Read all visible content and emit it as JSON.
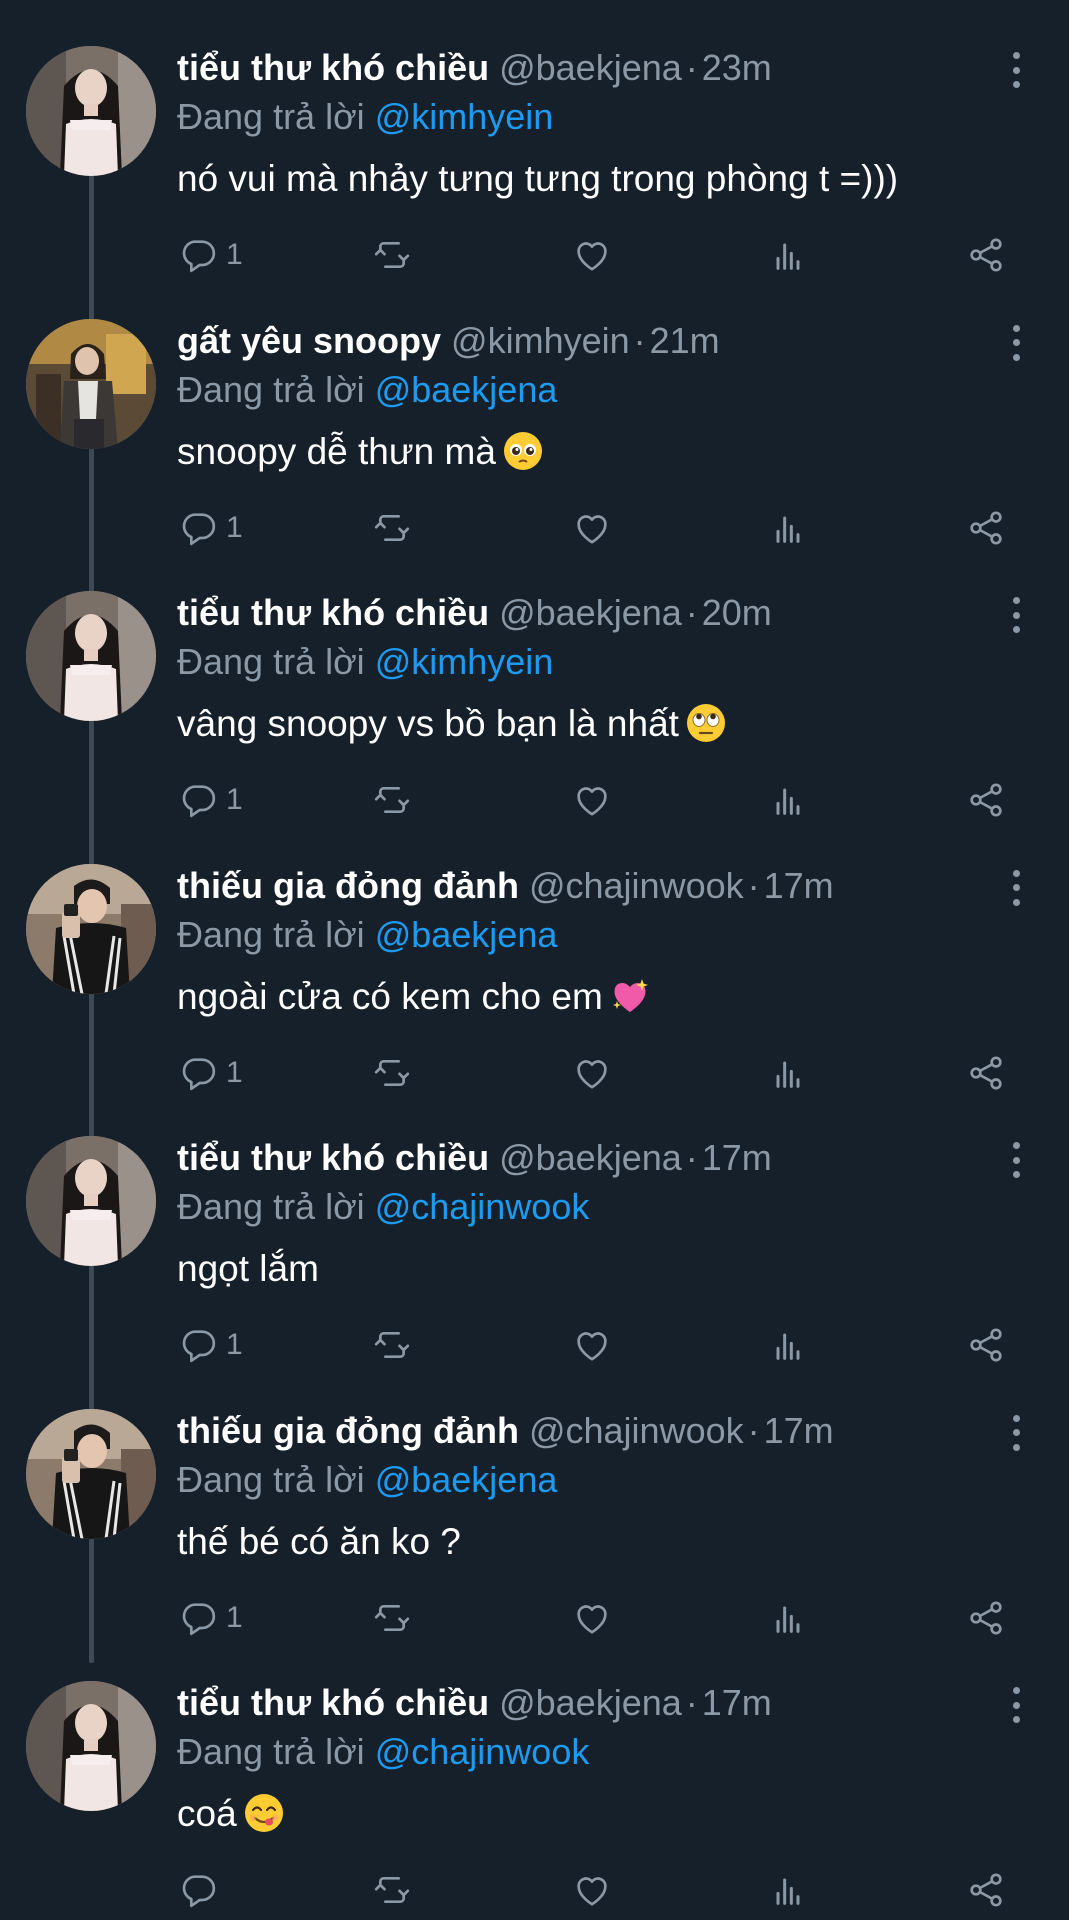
{
  "tweets": [
    {
      "name": "tiểu thư khó chiều",
      "handle": "@baekjena",
      "time": "23m",
      "replying_prefix": "Đang trả lời ",
      "replying_to": "@kimhyein",
      "text": "nó vui mà nhảy tưng tưng trong phòng t =)))",
      "emoji": "",
      "reply_count": "1"
    },
    {
      "name": "gất yêu snoopy",
      "handle": "@kimhyein",
      "time": "21m",
      "replying_prefix": "Đang trả lời ",
      "replying_to": "@baekjena",
      "text": "snoopy dễ thưn mà",
      "emoji": "pleading-face",
      "reply_count": "1"
    },
    {
      "name": "tiểu thư khó chiều",
      "handle": "@baekjena",
      "time": "20m",
      "replying_prefix": "Đang trả lời ",
      "replying_to": "@kimhyein",
      "text": "vâng snoopy vs bồ bạn là nhất",
      "emoji": "rolling-eyes-face",
      "reply_count": "1"
    },
    {
      "name": "thiếu gia đỏng đảnh",
      "handle": "@chajinwook",
      "time": "17m",
      "replying_prefix": "Đang trả lời ",
      "replying_to": "@baekjena",
      "text": "ngoài cửa có kem cho em",
      "emoji": "sparkling-heart",
      "reply_count": "1"
    },
    {
      "name": "tiểu thư khó chiều",
      "handle": "@baekjena",
      "time": "17m",
      "replying_prefix": "Đang trả lời ",
      "replying_to": "@chajinwook",
      "text": "ngọt lắm",
      "emoji": "",
      "reply_count": "1"
    },
    {
      "name": "thiếu gia đỏng đảnh",
      "handle": "@chajinwook",
      "time": "17m",
      "replying_prefix": "Đang trả lời ",
      "replying_to": "@baekjena",
      "text": "thế bé có ăn ko ?",
      "emoji": "",
      "reply_count": "1"
    },
    {
      "name": "tiểu thư khó chiều",
      "handle": "@baekjena",
      "time": "17m",
      "replying_prefix": "Đang trả lời ",
      "replying_to": "@chajinwook",
      "text": "coá",
      "emoji": "yum-face",
      "reply_count": ""
    }
  ],
  "icons": {
    "reply": "reply-icon",
    "retweet": "retweet-icon",
    "like": "heart-icon",
    "views": "views-icon",
    "share": "share-icon",
    "more": "more-vertical-icon"
  },
  "colors": {
    "background": "#15202b",
    "secondary_text": "#8b98a5",
    "mention": "#1d9bf0",
    "thread_line": "#3d4a56"
  }
}
